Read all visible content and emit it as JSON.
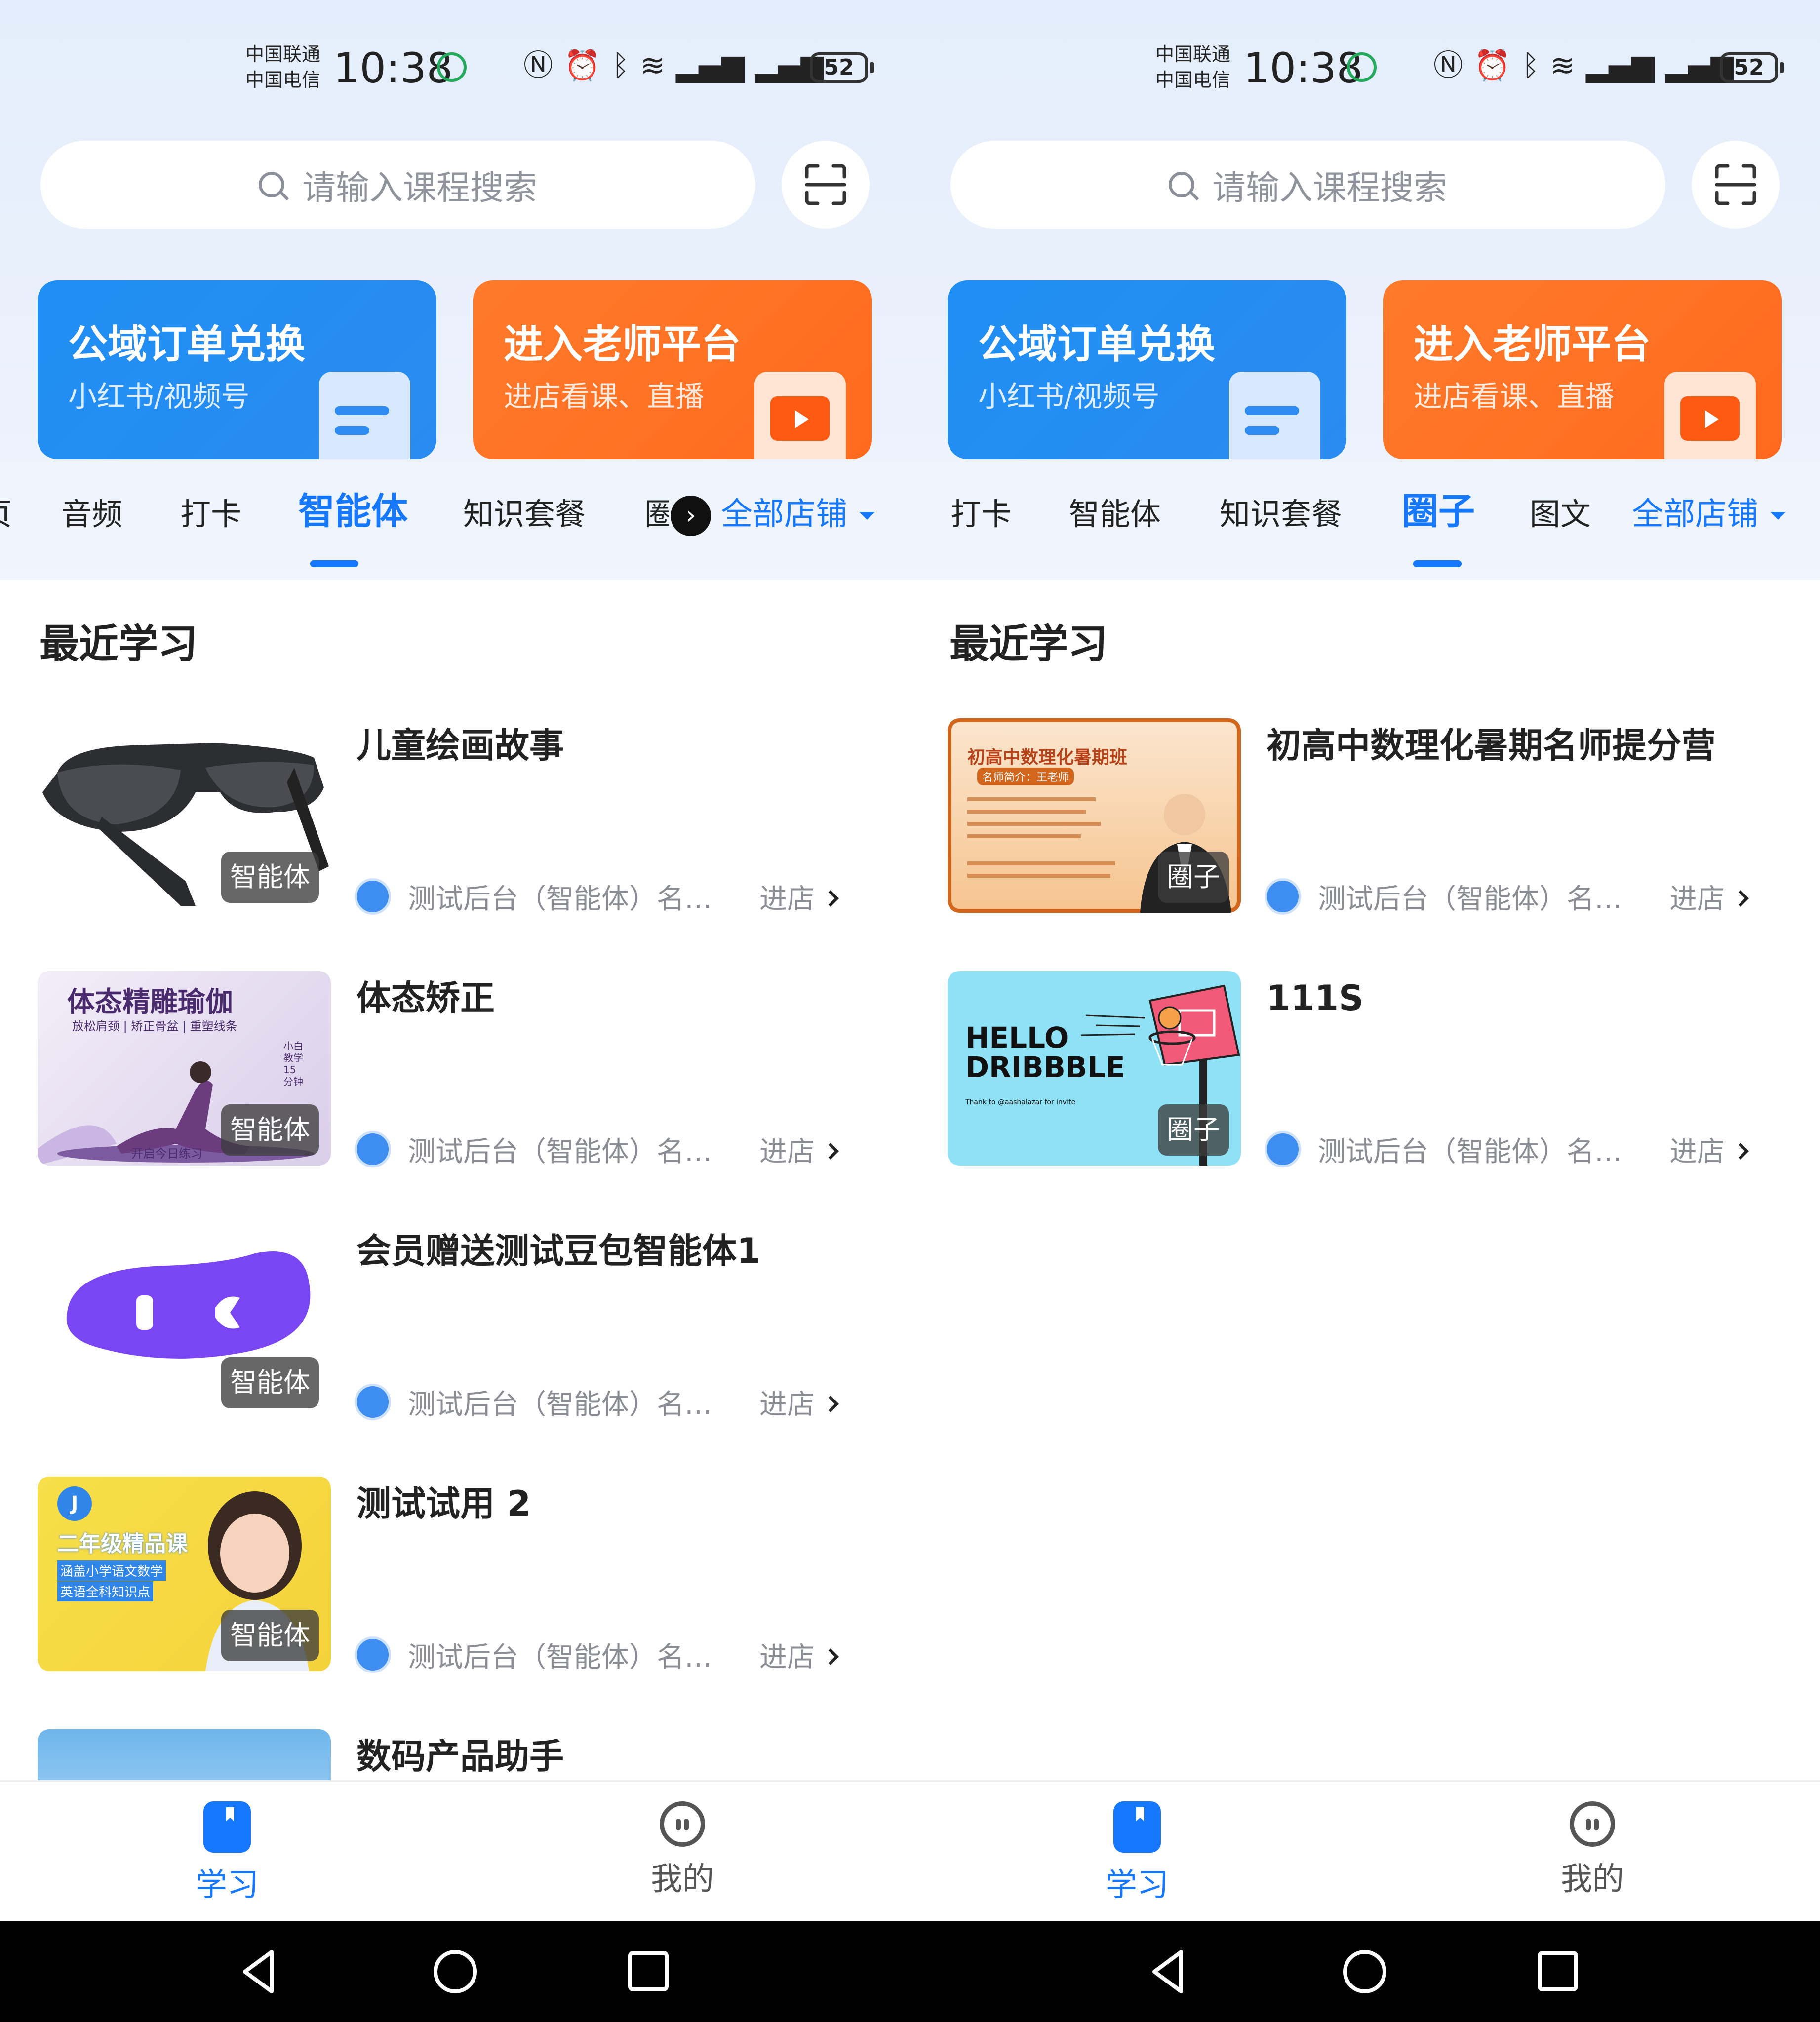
{
  "screens": [
    {
      "status": {
        "carrier1": "中国联通",
        "carrier2": "中国电信",
        "time": "10:38",
        "battery": "52"
      },
      "search": {
        "placeholder": "请输入课程搜索"
      },
      "banners": [
        {
          "title": "公域订单兑换",
          "subtitle": "小红书/视频号"
        },
        {
          "title": "进入老师平台",
          "subtitle": "进店看课、直播"
        }
      ],
      "tabs": [
        "页",
        "音频",
        "打卡",
        "智能体",
        "知识套餐",
        "圈子"
      ],
      "active_tab": "智能体",
      "store_dropdown": "全部店铺",
      "section_title": "最近学习",
      "items": [
        {
          "title": "儿童绘画故事",
          "badge": "智能体",
          "store": "测试后台（智能体）名…",
          "enter": "进店"
        },
        {
          "title": "体态矫正",
          "badge": "智能体",
          "store": "测试后台（智能体）名…",
          "enter": "进店",
          "thumb_text": {
            "title": "体态精雕瑜伽",
            "sub": "放松肩颈 | 矫正骨盆 | 重塑线条",
            "side": "小白教学 15分钟",
            "foot": "开启今日练习"
          }
        },
        {
          "title": "会员赠送测试豆包智能体1",
          "badge": "智能体",
          "store": "测试后台（智能体）名…",
          "enter": "进店"
        },
        {
          "title": "测试试用 2",
          "badge": "智能体",
          "store": "测试后台（智能体）名…",
          "enter": "进店",
          "thumb_text": {
            "title": "二年级精品课",
            "sub1": "涵盖小学语文数学",
            "sub2": "英语全科知识点"
          }
        },
        {
          "title": "数码产品助手"
        }
      ],
      "nav": [
        {
          "label": "学习"
        },
        {
          "label": "我的"
        }
      ]
    },
    {
      "status": {
        "carrier1": "中国联通",
        "carrier2": "中国电信",
        "time": "10:38",
        "battery": "52"
      },
      "search": {
        "placeholder": "请输入课程搜索"
      },
      "banners": [
        {
          "title": "公域订单兑换",
          "subtitle": "小红书/视频号"
        },
        {
          "title": "进入老师平台",
          "subtitle": "进店看课、直播"
        }
      ],
      "tabs": [
        "打卡",
        "智能体",
        "知识套餐",
        "圈子",
        "图文"
      ],
      "active_tab": "圈子",
      "store_dropdown": "全部店铺",
      "section_title": "最近学习",
      "items": [
        {
          "title": "初高中数理化暑期名师提分营",
          "badge": "圈子",
          "store": "测试后台（智能体）名…",
          "enter": "进店",
          "thumb_text": {
            "title": "初高中数理化暑期班",
            "sub": "名师简介：王老师"
          }
        },
        {
          "title": "111S",
          "badge": "圈子",
          "store": "测试后台（智能体）名…",
          "enter": "进店",
          "thumb_text": {
            "line1": "HELLO",
            "line2": "DRIBBBLE",
            "small": "Thank to @aashalazar for invite"
          }
        }
      ],
      "nav": [
        {
          "label": "学习"
        },
        {
          "label": "我的"
        }
      ]
    }
  ],
  "colors": {
    "accent": "#1677ff",
    "blue_banner": "#1f8ff5",
    "orange_banner": "#ff6a1e",
    "nav_bar": "#000000"
  },
  "icons": [
    "search-icon",
    "scan-icon",
    "document-icon",
    "video-play-icon",
    "chevron-right-icon",
    "study-book-icon",
    "profile-face-icon",
    "back-icon",
    "home-icon",
    "recents-icon"
  ]
}
